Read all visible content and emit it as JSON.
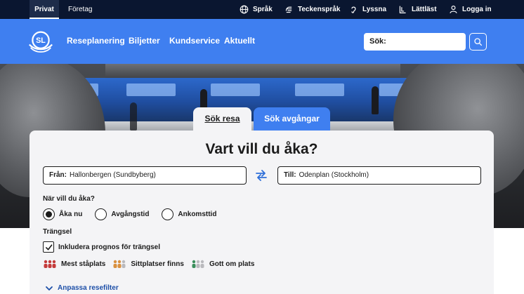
{
  "topbar": {
    "segments": [
      "Privat",
      "Företag"
    ],
    "utilities": [
      "Språk",
      "Teckenspråk",
      "Lyssna",
      "Lättläst",
      "Logga in"
    ]
  },
  "nav": {
    "logo_text": "SL",
    "links": [
      "Reseplanering",
      "Biljetter",
      "Kundservice",
      "Aktuellt"
    ],
    "search_label": "Sök:"
  },
  "tabs": [
    "Sök resa",
    "Sök avgångar"
  ],
  "form": {
    "title": "Vart vill du åka?",
    "from_label": "Från:",
    "from_value": "Hallonbergen (Sundbyberg)",
    "to_label": "Till:",
    "to_value": "Odenplan (Stockholm)",
    "when_label": "När vill du åka?",
    "time_options": [
      "Åka nu",
      "Avgångstid",
      "Ankomsttid"
    ],
    "selected_time_option": "Åka nu",
    "crowding_label": "Trängsel",
    "crowding_checkbox": "Inkludera prognos för trängsel",
    "crowding_checked": true,
    "legend": [
      "Mest ståplats",
      "Sittplatser finns",
      "Gott om plats"
    ],
    "filter_link": "Anpassa resefilter"
  },
  "colors": {
    "brand_blue": "#3f7ff0",
    "topbar": "#0a1630",
    "crowd_high": "#c43a3a",
    "crowd_mid": "#d9903f",
    "crowd_low": "#3b8f5c"
  }
}
